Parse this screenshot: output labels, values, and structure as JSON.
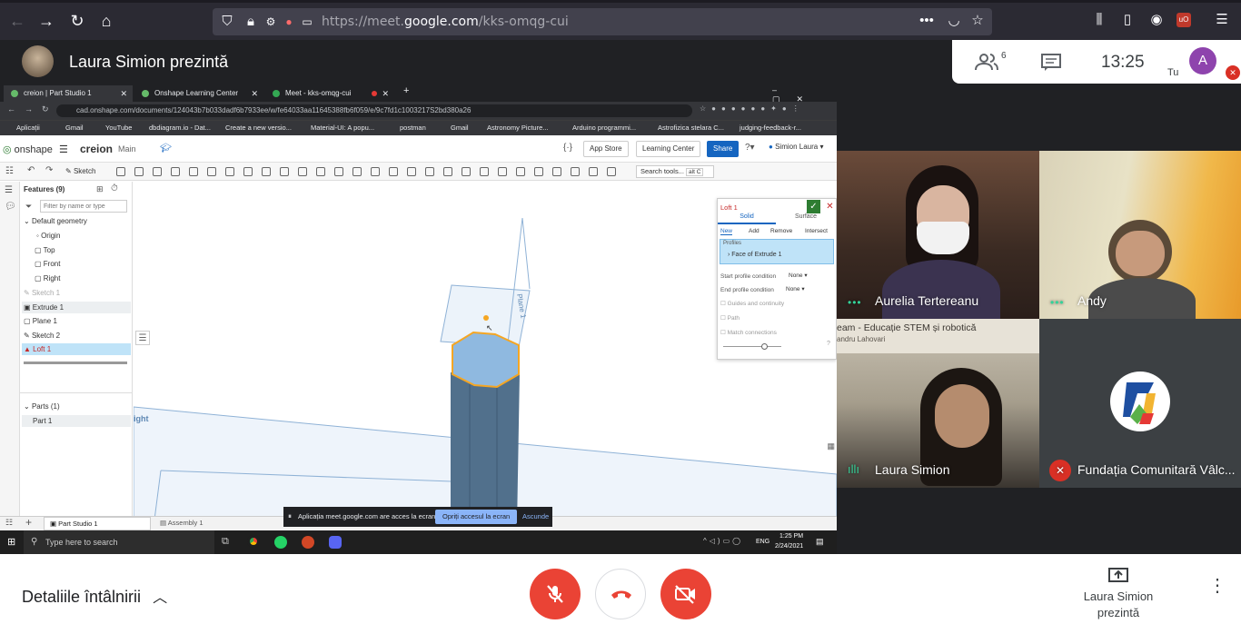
{
  "browser": {
    "url_prefix": "https://meet.",
    "url_domain": "google.com",
    "url_path": "/kks-omqg-cui"
  },
  "meet": {
    "presenter_title": "Laura Simion prezintă",
    "people_count": "6",
    "clock": "13:25",
    "self_initial": "A",
    "self_label": "Tu",
    "meeting_details": "Detaliile întâlnirii",
    "present_label": "Laura Simion prezintă",
    "colors": {
      "red": "#ea4335",
      "dark": "#202124",
      "speaking": "#34d399"
    }
  },
  "participants": [
    {
      "name": "Aurelia Tertereanu",
      "speaking": true
    },
    {
      "name": "Andy",
      "speaking": true
    },
    {
      "name": "Laura Simion",
      "speaking": true,
      "banner": "eam - Educație STEM și robotică",
      "banner_sub": "andru Lahovari"
    },
    {
      "name": "Fundația Comunitară Vâlc...",
      "muted": true
    }
  ],
  "shared": {
    "chrome_tabs": [
      {
        "label": "creion | Part Studio 1",
        "color": "#66bb6a"
      },
      {
        "label": "Onshape Learning Center",
        "color": "#66bb6a"
      },
      {
        "label": "Meet - kks-omqg-cui",
        "color": "#34a853"
      }
    ],
    "address": "cad.onshape.com/documents/124043b7b033dadf6b7933ee/w/fe64033aa11645388fb6f059/e/9c7fd1c1003217S2bd380a26",
    "bookmarks": [
      "Aplicații",
      "Gmail",
      "YouTube",
      "dbdiagram.io - Dat...",
      "Create a new versio...",
      "Material-UI: A popu...",
      "postman",
      "Gmail",
      "Astronomy Picture...",
      "Arduino programmi...",
      "Astrofizica stelara C...",
      "judging-feedback-r..."
    ],
    "onshape": {
      "logo": "onshape",
      "doc_title": "creion",
      "branch": "Main",
      "app_store": "App Store",
      "learning_center": "Learning Center",
      "share": "Share",
      "user": "Simion Laura",
      "sketch": "Sketch",
      "search_tools": "Search tools...",
      "search_shortcut": "alt C",
      "features_header": "Features (9)",
      "filter_placeholder": "Filter by name or type",
      "features": [
        {
          "label": "Default geometry"
        },
        {
          "label": "Origin"
        },
        {
          "label": "Top"
        },
        {
          "label": "Front"
        },
        {
          "label": "Right"
        },
        {
          "label": "Sketch 1"
        },
        {
          "label": "Extrude 1"
        },
        {
          "label": "Plane 1"
        },
        {
          "label": "Sketch 2"
        },
        {
          "label": "Loft 1"
        }
      ],
      "parts_header": "Parts (1)",
      "part": "Part 1",
      "plane_label": "Plane 1",
      "right_label": "ight",
      "loft": {
        "title": "Loft 1",
        "tab_solid": "Solid",
        "tab_surface": "Surface",
        "op_new": "New",
        "op_add": "Add",
        "op_remove": "Remove",
        "op_intersect": "Intersect",
        "profiles_label": "Profiles",
        "profile_item": "Face of Extrude 1",
        "start_label": "Start profile condition",
        "start_value": "None",
        "end_label": "End profile condition",
        "end_value": "None",
        "guides": "Guides and continuity",
        "path": "Path",
        "match": "Match connections"
      },
      "tab_part_studio": "Part Studio 1",
      "tab_assembly": "Assembly 1"
    },
    "notification": {
      "text": "Aplicația meet.google.com are acces la ecran.",
      "stop": "Opriți accesul la ecran",
      "hide": "Ascunde"
    },
    "taskbar": {
      "search": "Type here to search",
      "lang": "ENG",
      "time": "1:25 PM",
      "date": "2/24/2021"
    }
  }
}
